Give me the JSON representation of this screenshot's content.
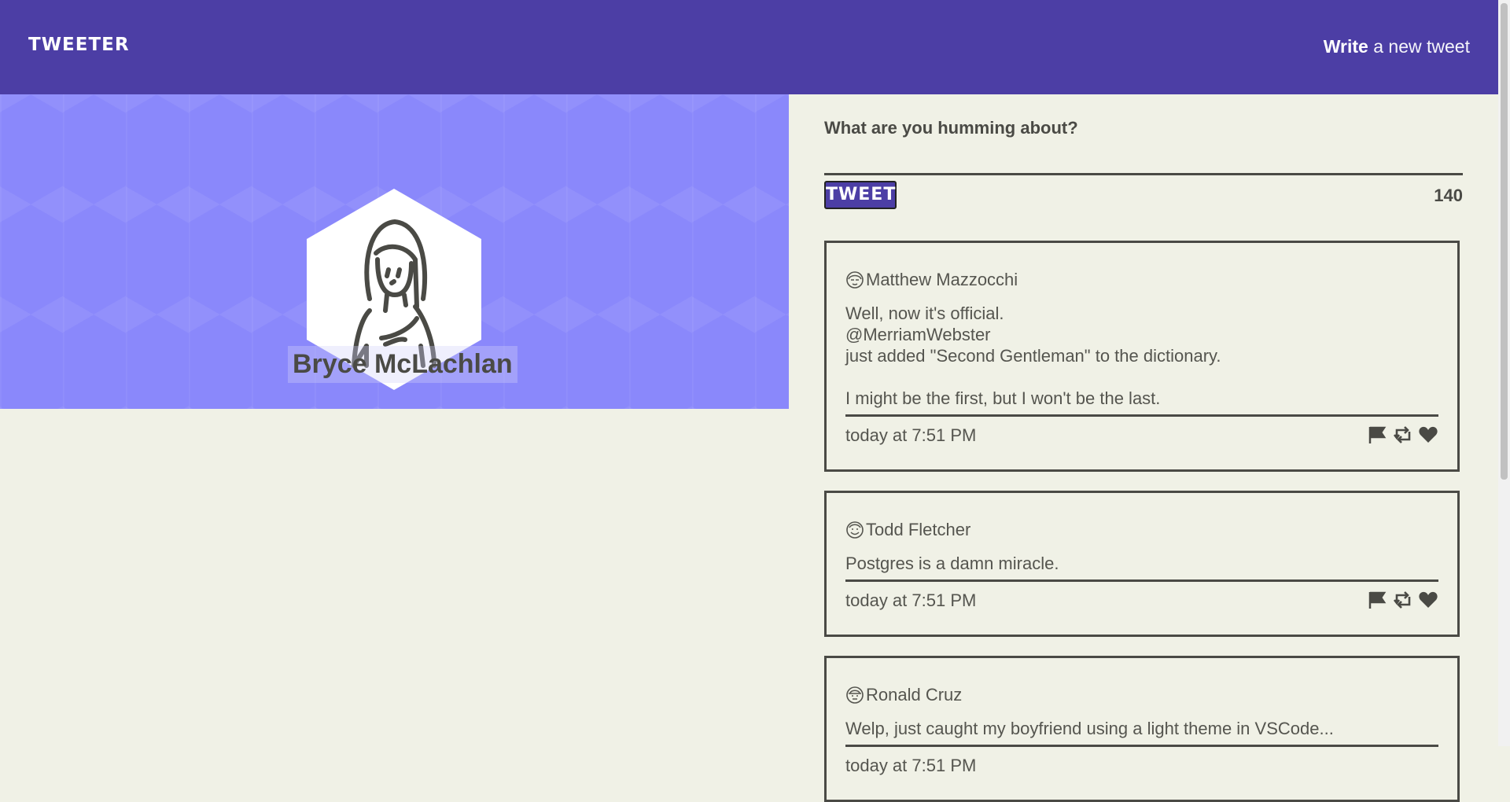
{
  "nav": {
    "brand": "TWEETER",
    "compose_bold": "Write",
    "compose_rest": " a new tweet"
  },
  "profile": {
    "name": "Bryce McLachlan",
    "avatar_icon": "person-long-hair-icon"
  },
  "composer": {
    "prompt": "What are you humming about?",
    "button": "TWEET",
    "counter": "140"
  },
  "tweets": [
    {
      "author": "Matthew Mazzocchi",
      "body": "Well, now it's official.\n@MerriamWebster\njust added \"Second Gentleman\" to the dictionary.\n\nI might be the first, but I won't be the last.",
      "time": "today at 7:51 PM"
    },
    {
      "author": "Todd Fletcher",
      "body": "Postgres is a damn miracle.",
      "time": "today at 7:51 PM"
    },
    {
      "author": "Ronald Cruz",
      "body": "Welp, just caught my boyfriend using a light theme in VSCode...",
      "time": "today at 7:51 PM"
    }
  ],
  "icons": [
    "flag-icon",
    "retweet-icon",
    "heart-icon"
  ],
  "colors": {
    "nav": "#4c3ea5",
    "banner": "#8a88fb",
    "background": "#f0f1e6",
    "text": "#4a4a45"
  }
}
